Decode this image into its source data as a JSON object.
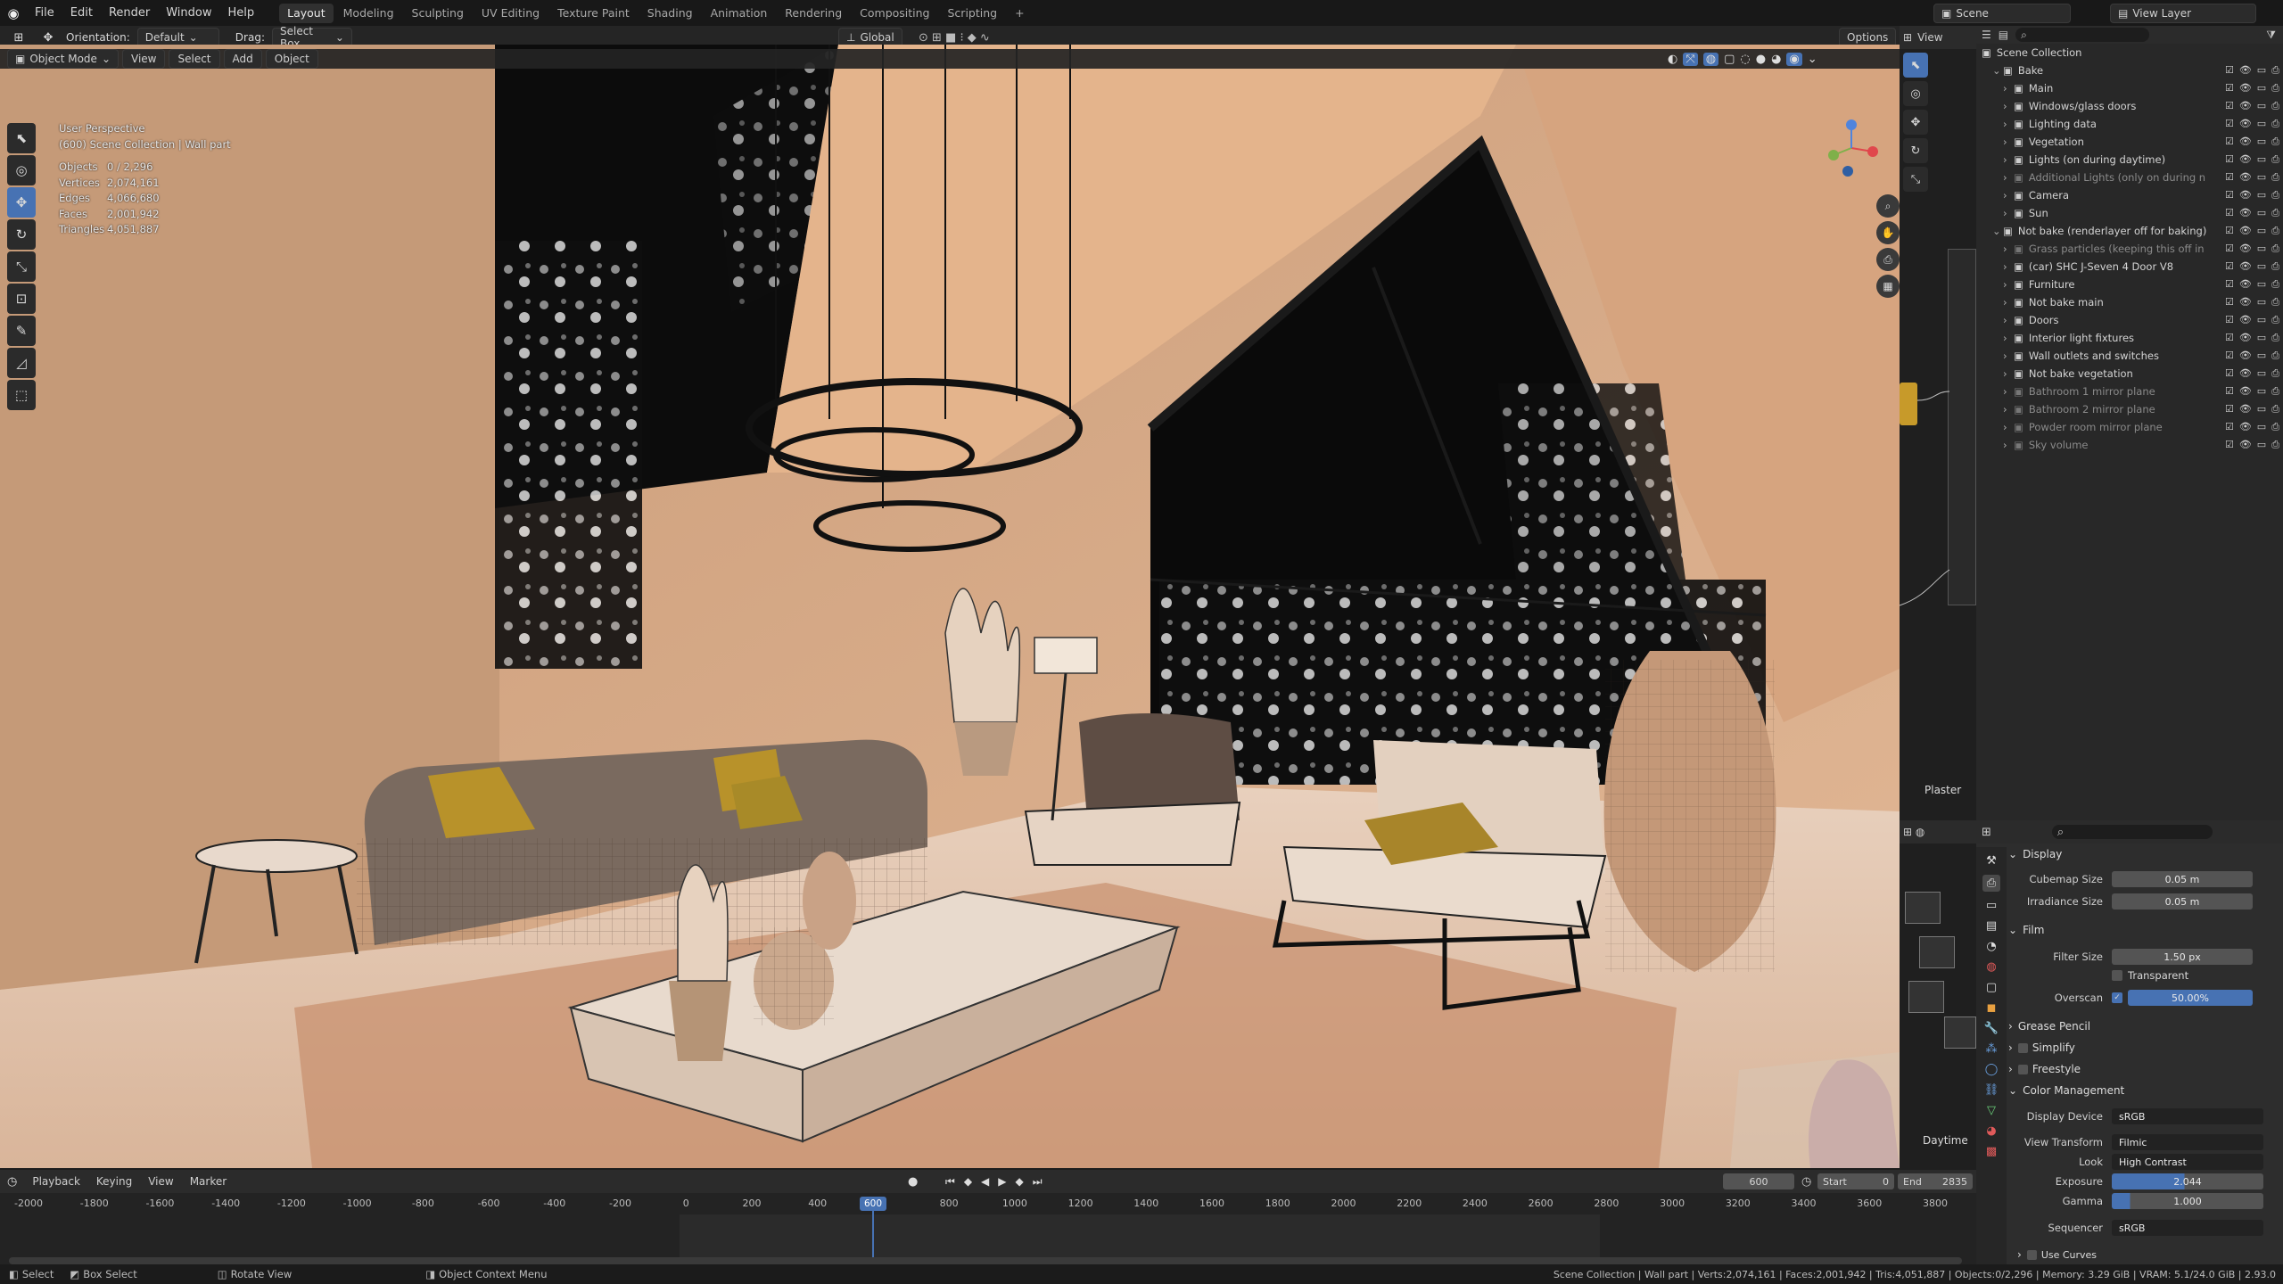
{
  "topbar": {
    "menus": [
      "File",
      "Edit",
      "Render",
      "Window",
      "Help"
    ],
    "workspaces": [
      "Layout",
      "Modeling",
      "Sculpting",
      "UV Editing",
      "Texture Paint",
      "Shading",
      "Animation",
      "Rendering",
      "Compositing",
      "Scripting"
    ],
    "active_workspace": "Layout",
    "add_tab": "+",
    "scene_label": "Scene",
    "viewlayer_label": "View Layer"
  },
  "header2": {
    "orientation_label": "Orientation:",
    "orientation_value": "Default",
    "drag_label": "Drag:",
    "drag_value": "Select Box",
    "transform": "Global",
    "options": "Options"
  },
  "header3": {
    "mode": "Object Mode",
    "menus": [
      "View",
      "Select",
      "Add",
      "Object"
    ]
  },
  "viewport": {
    "perspective": "User Perspective",
    "collection": "(600) Scene Collection | Wall part",
    "stats": [
      {
        "k": "Objects",
        "v": "0 / 2,296"
      },
      {
        "k": "Vertices",
        "v": "2,074,161"
      },
      {
        "k": "Edges",
        "v": "4,066,680"
      },
      {
        "k": "Faces",
        "v": "2,001,942"
      },
      {
        "k": "Triangles",
        "v": "4,051,887"
      }
    ]
  },
  "outliner": {
    "root": "Scene Collection",
    "search_placeholder": "",
    "rows": [
      {
        "t": "Bake",
        "lvl": 1,
        "dim": false
      },
      {
        "t": "Main",
        "lvl": 2,
        "dim": false
      },
      {
        "t": "Windows/glass doors",
        "lvl": 2,
        "dim": false
      },
      {
        "t": "Lighting data",
        "lvl": 2,
        "dim": false
      },
      {
        "t": "Vegetation",
        "lvl": 2,
        "dim": false
      },
      {
        "t": "Lights (on during daytime)",
        "lvl": 2,
        "dim": false
      },
      {
        "t": "Additional Lights (only on during n",
        "lvl": 2,
        "dim": true
      },
      {
        "t": "Camera",
        "lvl": 2,
        "dim": false
      },
      {
        "t": "Sun",
        "lvl": 2,
        "dim": false
      },
      {
        "t": "Not bake (renderlayer off for baking)",
        "lvl": 1,
        "dim": false
      },
      {
        "t": "Grass particles (keeping this off in",
        "lvl": 2,
        "dim": true
      },
      {
        "t": "(car) SHC J-Seven 4 Door V8",
        "lvl": 2,
        "dim": false
      },
      {
        "t": "Furniture",
        "lvl": 2,
        "dim": false
      },
      {
        "t": "Not bake main",
        "lvl": 2,
        "dim": false
      },
      {
        "t": "Doors",
        "lvl": 2,
        "dim": false
      },
      {
        "t": "Interior light fixtures",
        "lvl": 2,
        "dim": false
      },
      {
        "t": "Wall outlets and switches",
        "lvl": 2,
        "dim": false
      },
      {
        "t": "Not bake vegetation",
        "lvl": 2,
        "dim": false
      },
      {
        "t": "Bathroom 1 mirror plane",
        "lvl": 2,
        "dim": true
      },
      {
        "t": "Bathroom 2 mirror plane",
        "lvl": 2,
        "dim": true
      },
      {
        "t": "Powder room mirror plane",
        "lvl": 2,
        "dim": true
      },
      {
        "t": "Sky volume",
        "lvl": 2,
        "dim": true
      }
    ]
  },
  "node_editor": {
    "label_plaster": "Plaster",
    "label_daytime": "Daytime",
    "view": "View"
  },
  "properties": {
    "display": "Display",
    "cubemap_label": "Cubemap Size",
    "cubemap_value": "0.05 m",
    "irradiance_label": "Irradiance Size",
    "irradiance_value": "0.05 m",
    "film": "Film",
    "filter_label": "Filter Size",
    "filter_value": "1.50 px",
    "transparent": "Transparent",
    "overscan_label": "Overscan",
    "overscan_value": "50.00%",
    "grease": "Grease Pencil",
    "simplify": "Simplify",
    "freestyle": "Freestyle",
    "colormgmt": "Color Management",
    "display_device_label": "Display Device",
    "display_device": "sRGB",
    "view_transform_label": "View Transform",
    "view_transform": "Filmic",
    "look_label": "Look",
    "look": "High Contrast",
    "exposure_label": "Exposure",
    "exposure": "2.044",
    "gamma_label": "Gamma",
    "gamma": "1.000",
    "sequencer_label": "Sequencer",
    "sequencer": "sRGB",
    "use_curves": "Use Curves"
  },
  "timeline": {
    "menus": [
      "Playback",
      "Keying",
      "View",
      "Marker"
    ],
    "current": "600",
    "start_label": "Start",
    "start": "0",
    "end_label": "End",
    "end": "2835",
    "ticks": [
      "-2000",
      "-1800",
      "-1600",
      "-1400",
      "-1200",
      "-1000",
      "-800",
      "-600",
      "-400",
      "-200",
      "0",
      "200",
      "400",
      "600",
      "800",
      "1000",
      "1200",
      "1400",
      "1600",
      "1800",
      "2000",
      "2200",
      "2400",
      "2600",
      "2800",
      "3000",
      "3200",
      "3400",
      "3600",
      "3800"
    ]
  },
  "status": {
    "select": "Select",
    "box_select": "Box Select",
    "rotate": "Rotate View",
    "context": "Object Context Menu",
    "info": "Scene Collection | Wall part | Verts:2,074,161 | Faces:2,001,942 | Tris:4,051,887 | Objects:0/2,296 | Memory: 3.29 GiB | VRAM: 5.1/24.0 GiB | 2.93.0"
  }
}
